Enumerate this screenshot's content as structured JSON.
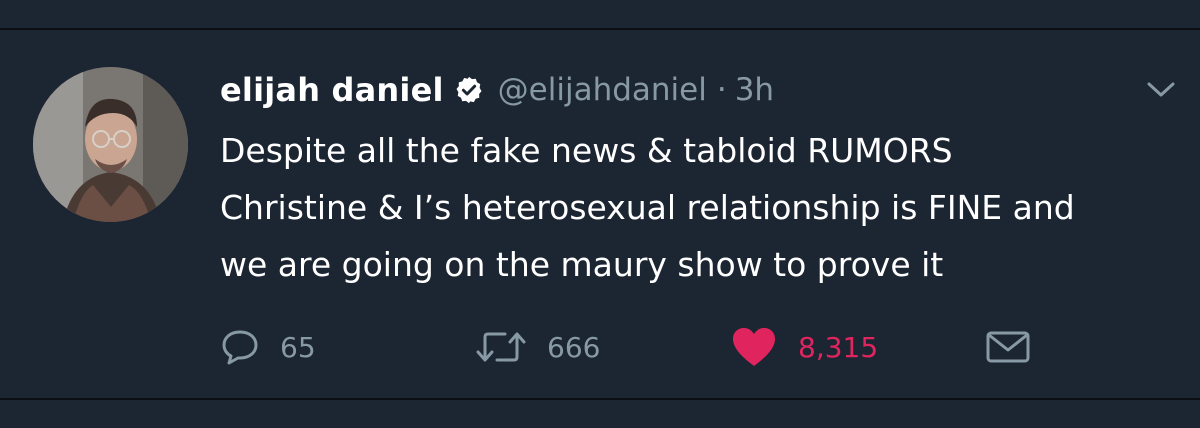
{
  "tweet": {
    "author_name": "elijah daniel",
    "handle": "@elijahdaniel",
    "separator": "·",
    "time": "3h",
    "verified": true,
    "text_lines": [
      "Despite all the fake news & tabloid RUMORS",
      "Christine & I’s heterosexual relationship is FINE and",
      "we are going on the maury show to prove it"
    ]
  },
  "actions": {
    "reply_count": "65",
    "retweet_count": "666",
    "like_count": "8,315",
    "icons": [
      "reply-icon",
      "retweet-icon",
      "heart-icon",
      "mail-icon"
    ]
  },
  "colors": {
    "background": "#1c2532",
    "secondary_text": "#8899a6",
    "like": "#e0245e",
    "text": "#ffffff"
  }
}
